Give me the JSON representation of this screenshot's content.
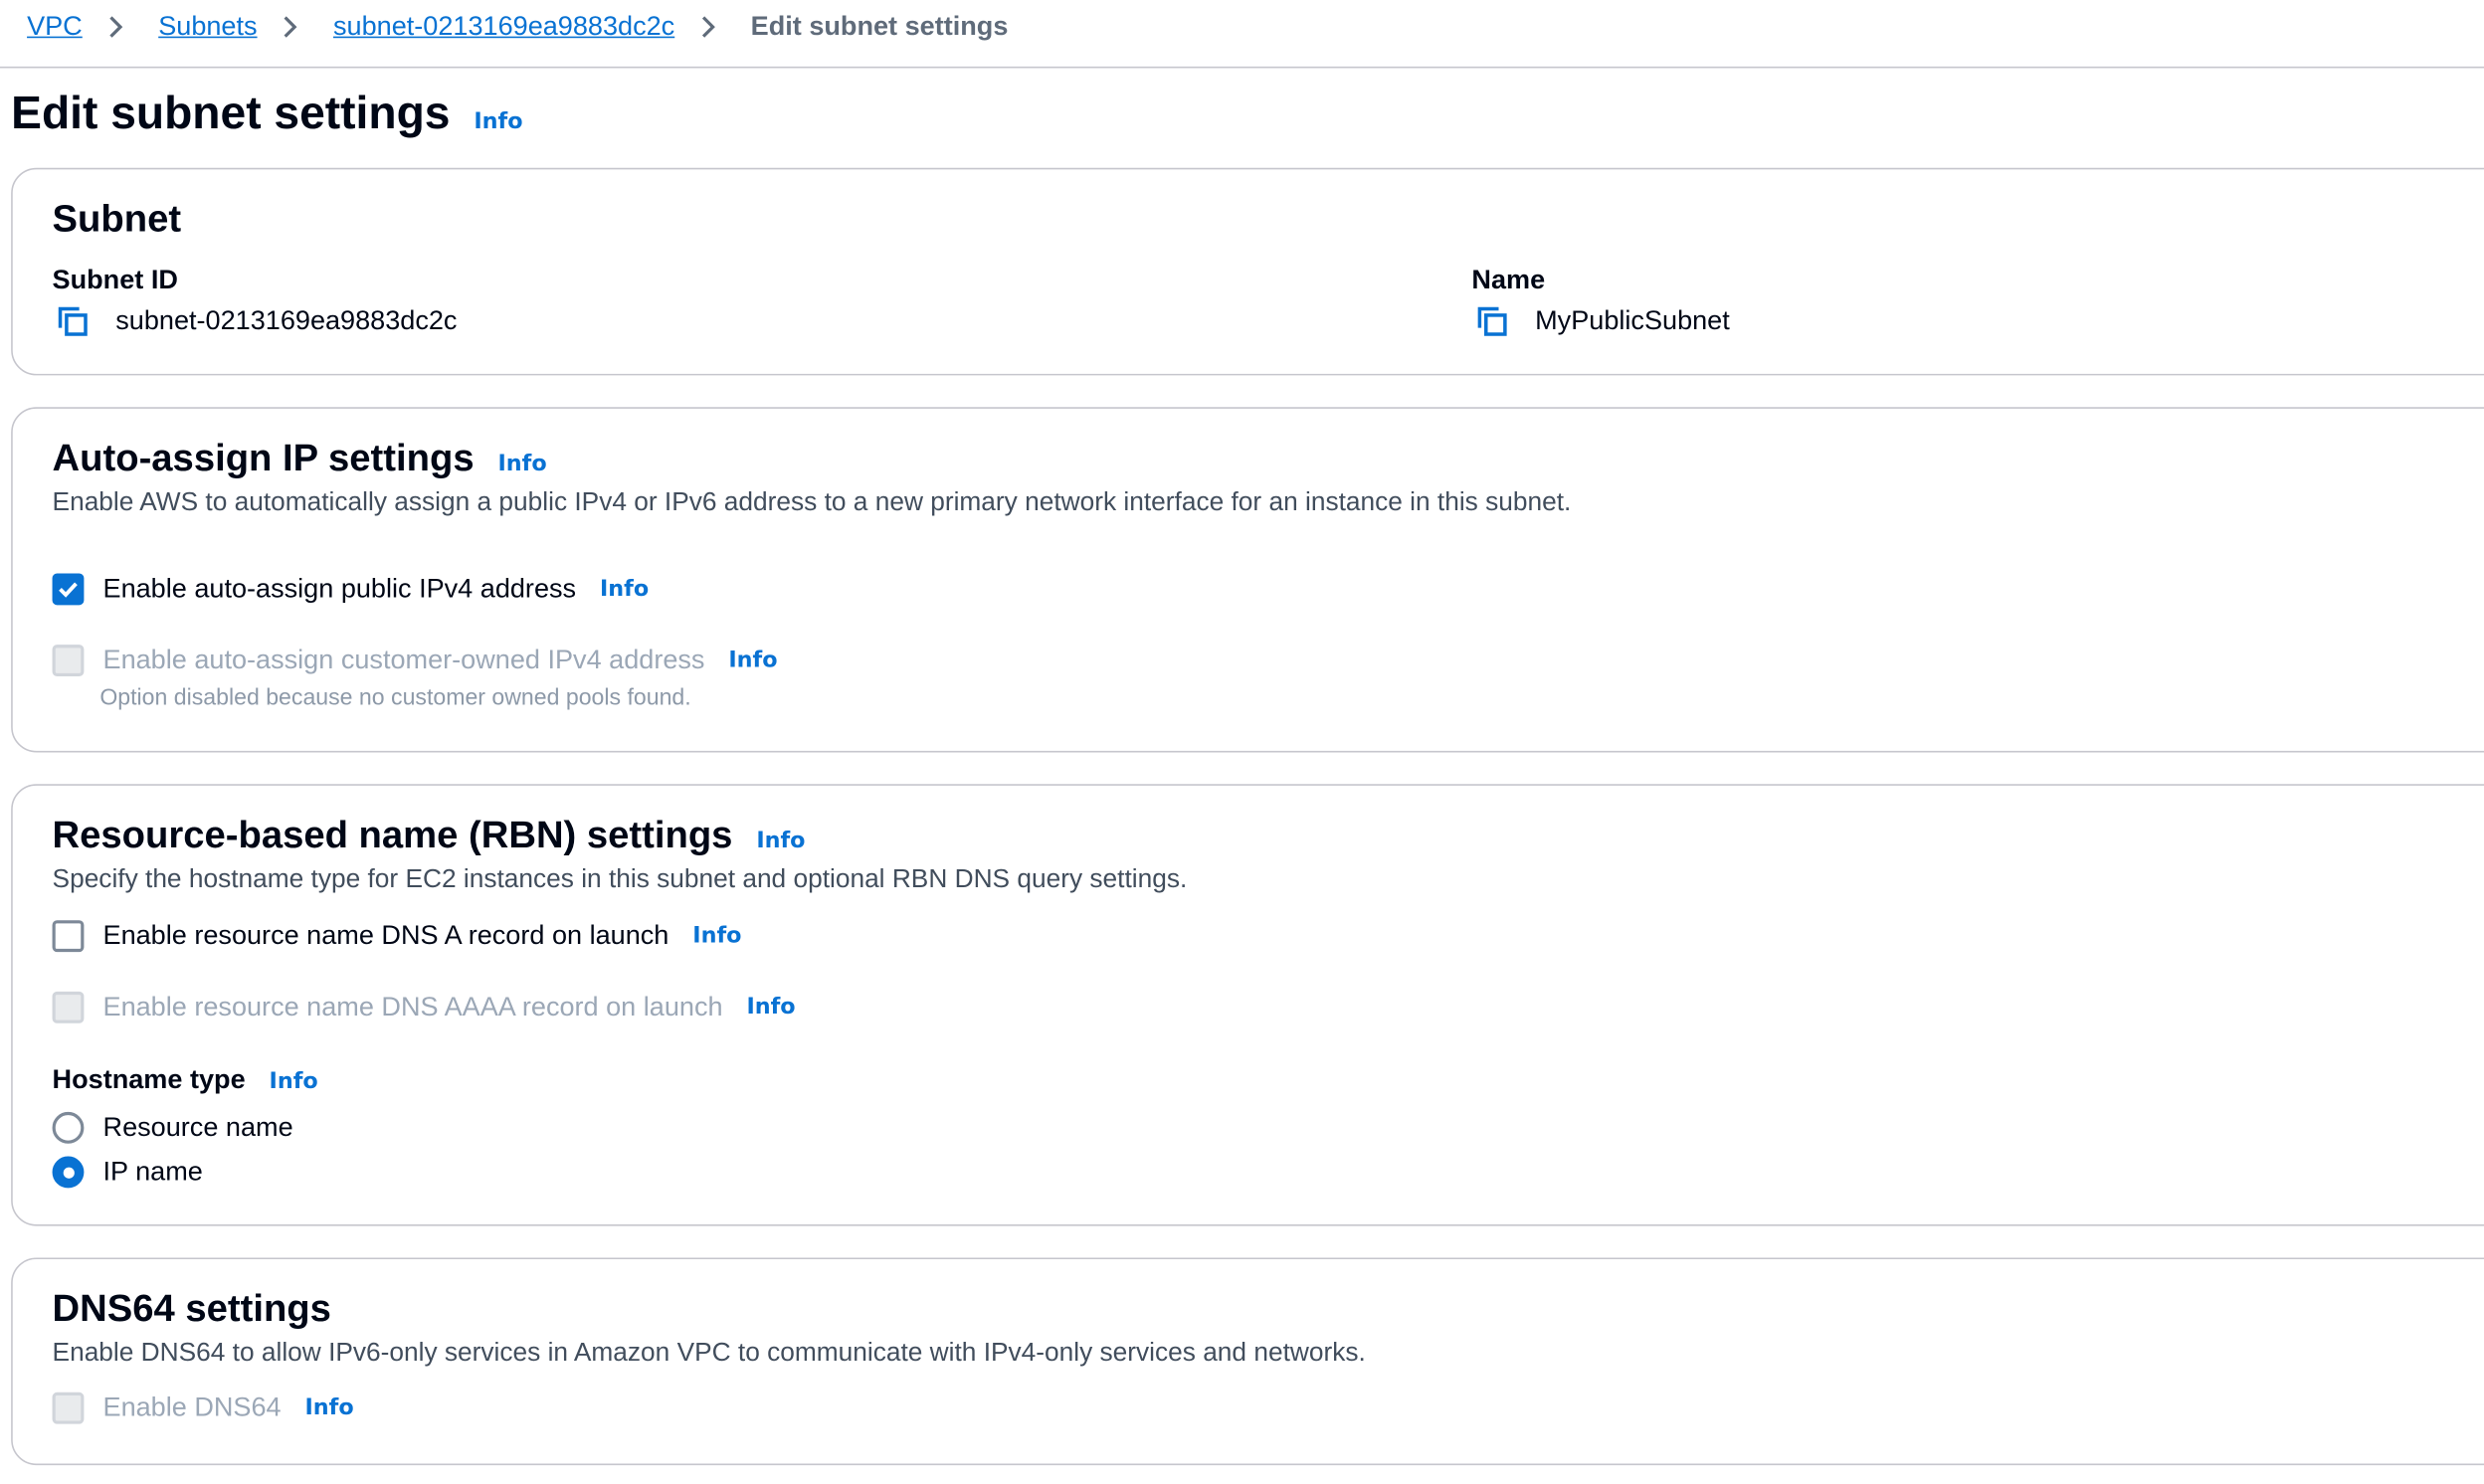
{
  "breadcrumb": {
    "items": [
      "VPC",
      "Subnets",
      "subnet-0213169ea9883dc2c"
    ],
    "current": "Edit subnet settings"
  },
  "page": {
    "title": "Edit subnet settings",
    "info": "Info"
  },
  "subnet_panel": {
    "title": "Subnet",
    "subnet_id_label": "Subnet ID",
    "subnet_id_value": "subnet-0213169ea9883dc2c",
    "name_label": "Name",
    "name_value": "MyPublicSubnet",
    "copy_icon": "copy-icon"
  },
  "auto_assign": {
    "title": "Auto-assign IP settings",
    "info": "Info",
    "description": "Enable AWS to automatically assign a public IPv4 or IPv6 address to a new primary network interface for an instance in this subnet.",
    "public_ipv4": {
      "label": "Enable auto-assign public IPv4 address",
      "info": "Info",
      "checked": true
    },
    "customer_owned_ipv4": {
      "label": "Enable auto-assign customer-owned IPv4 address",
      "info": "Info",
      "checked": false,
      "disabled": true,
      "hint": "Option disabled because no customer owned pools found."
    }
  },
  "rbn": {
    "title": "Resource-based name (RBN) settings",
    "info": "Info",
    "description": "Specify the hostname type for EC2 instances in this subnet and optional RBN DNS query settings.",
    "dns_a": {
      "label": "Enable resource name DNS A record on launch",
      "info": "Info",
      "checked": false
    },
    "dns_aaaa": {
      "label": "Enable resource name DNS AAAA record on launch",
      "info": "Info",
      "checked": false,
      "disabled": true
    },
    "hostname_type": {
      "label": "Hostname type",
      "info": "Info",
      "options": [
        "Resource name",
        "IP name"
      ],
      "selected": "IP name"
    }
  },
  "dns64": {
    "title": "DNS64 settings",
    "description": "Enable DNS64 to allow IPv6-only services in Amazon VPC to communicate with IPv4-only services and networks.",
    "enable": {
      "label": "Enable DNS64",
      "info": "Info",
      "checked": false,
      "disabled": true
    }
  },
  "colors": {
    "link": "#0972d3",
    "text": "#000716",
    "border": "#c6c6cd",
    "disabled_text": "#9ba7b6"
  }
}
